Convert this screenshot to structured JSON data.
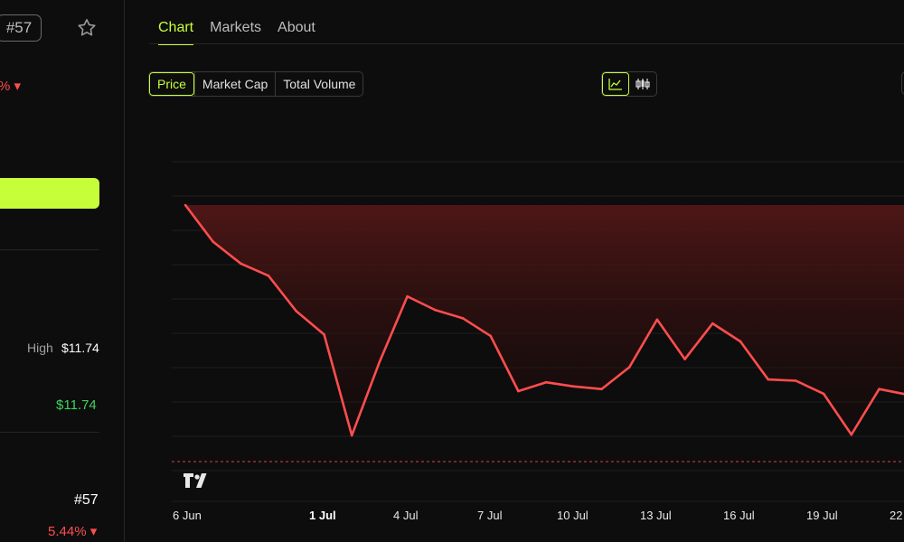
{
  "sidebar": {
    "rank_badge": "#57",
    "price_change_top": "% ▾",
    "high_label": "High",
    "high_value": "$11.74",
    "green_value": "$11.74",
    "rank_value": "#57",
    "change_bottom": "5.44% ▾"
  },
  "tabs": [
    {
      "label": "Chart",
      "active": true
    },
    {
      "label": "Markets",
      "active": false
    },
    {
      "label": "About",
      "active": false
    }
  ],
  "metric_buttons": [
    {
      "label": "Price",
      "active": true
    },
    {
      "label": "Market Cap",
      "active": false
    },
    {
      "label": "Total Volume",
      "active": false
    }
  ],
  "view_modes": [
    {
      "icon": "line-chart-icon",
      "active": true
    },
    {
      "icon": "candlestick-icon",
      "active": false
    }
  ],
  "colors": {
    "accent": "#c6ff3a",
    "line": "#ff4d4d",
    "negative": "#ff4d4d",
    "positive": "#3ed45a"
  },
  "watermark": "TradingView logo",
  "chart_data": {
    "type": "area",
    "title": "",
    "xlabel": "",
    "ylabel": "",
    "x_ticks": [
      {
        "label": "6 Jun",
        "bold": false
      },
      {
        "label": "1 Jul",
        "bold": true
      },
      {
        "label": "4 Jul",
        "bold": false
      },
      {
        "label": "7 Jul",
        "bold": false
      },
      {
        "label": "10 Jul",
        "bold": false
      },
      {
        "label": "13 Jul",
        "bold": false
      },
      {
        "label": "16 Jul",
        "bold": false
      },
      {
        "label": "19 Jul",
        "bold": false
      },
      {
        "label": "22",
        "bold": false
      }
    ],
    "grid": true,
    "y_axis_labels_visible": false,
    "series": [
      {
        "values": [
          100,
          85.9,
          77.5,
          72.8,
          59.2,
          50.3,
          11.5,
          39.8,
          64.9,
          59.7,
          56.5,
          49.7,
          28.5,
          31.9,
          30.3,
          29.3,
          37.7,
          56.0,
          40.8,
          54.5,
          47.6,
          33.0,
          32.5,
          27.5,
          11.8,
          29.3,
          27.2
        ]
      }
    ],
    "baseline_dashed": true
  }
}
